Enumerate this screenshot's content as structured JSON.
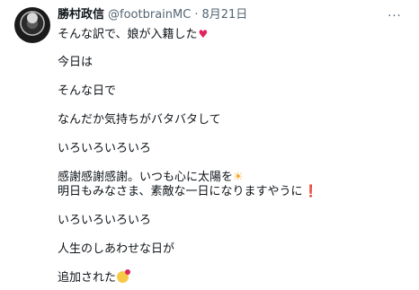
{
  "author": {
    "display_name": "勝村政信",
    "handle": "@footbrainMC",
    "separator": "·",
    "date": "8月21日"
  },
  "more_label": "···",
  "post": {
    "lines": [
      "そんな訳で、娘が入籍した",
      "今日は",
      "そんな日で",
      "なんだか気持ちがバタバタして",
      "いろいろいろいろ",
      "感謝感謝感謝。いつも心に太陽を",
      "明日もみなさま、素敵な一日になりますやうに",
      "いろいろいろいろ",
      "人生のしあわせな日が",
      "追加された"
    ]
  },
  "icons": {
    "heart": "red-heart-icon",
    "sun": "sun-icon",
    "exclamation": "red-exclamation-icon",
    "party_face": "smiling-face-with-hearts-icon"
  }
}
